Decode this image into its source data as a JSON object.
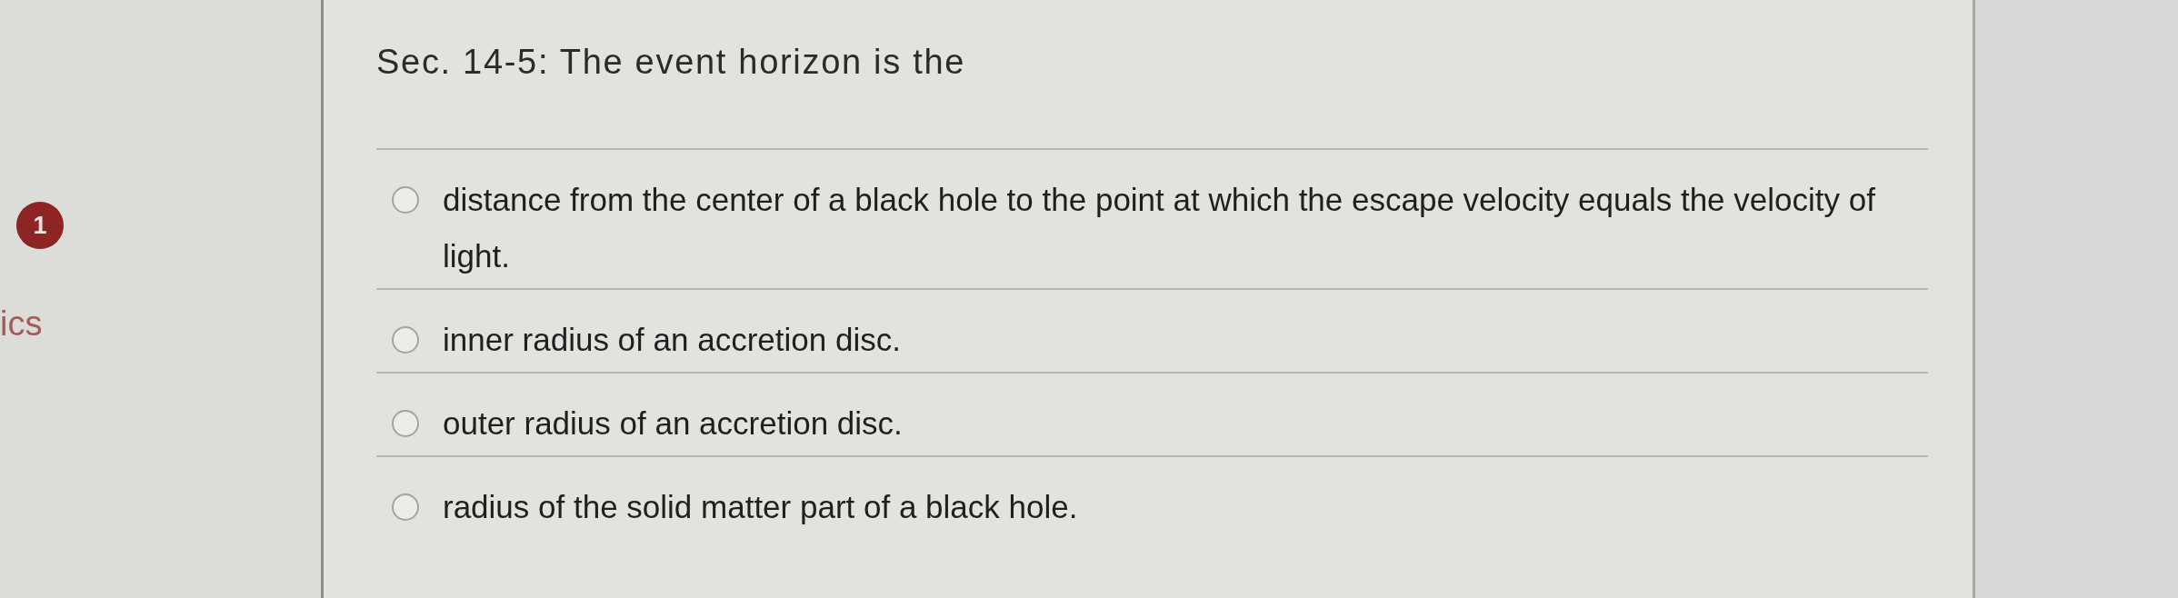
{
  "sidebar": {
    "badge": "1",
    "label": "ics"
  },
  "question": {
    "title": "Sec. 14-5: The event horizon is the",
    "options": [
      {
        "text": "distance from the center of a black hole to the point at which the escape velocity equals the velocity of light.",
        "selected": false
      },
      {
        "text": "inner radius of an accretion disc.",
        "selected": false
      },
      {
        "text": "outer radius of an accretion disc.",
        "selected": false
      },
      {
        "text": "radius of the solid matter part of a black hole.",
        "selected": false
      }
    ]
  }
}
